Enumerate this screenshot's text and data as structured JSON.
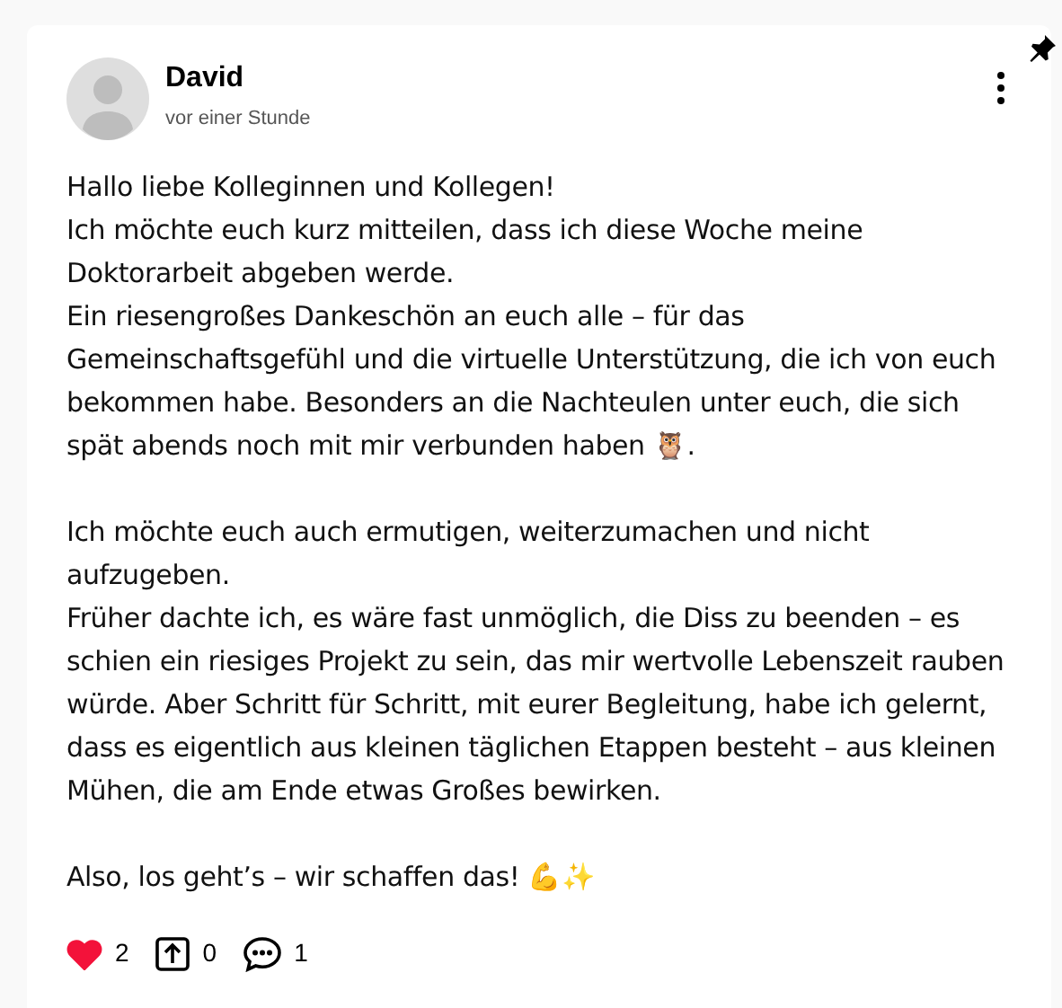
{
  "post": {
    "author": "David",
    "time": "vor einer Stunde",
    "pinned": true,
    "paragraphs": [
      [
        "Hallo liebe Kolleginnen und Kollegen!",
        "Ich möchte euch kurz mitteilen, dass ich diese Woche meine Doktorarbeit abgeben werde.",
        "Ein riesengroßes Dankeschön an euch alle – für das Gemeinschaftsgefühl und die virtuelle Unterstützung, die ich von euch bekommen habe. Besonders an die Nachteulen unter euch, die sich spät abends noch mit mir verbunden haben 🦉."
      ],
      [
        "Ich möchte euch auch ermutigen, weiterzumachen und nicht aufzugeben.",
        "Früher dachte ich, es wäre fast unmöglich, die Diss zu beenden – es schien ein riesiges Projekt zu sein, das mir wertvolle Lebenszeit rauben würde. Aber Schritt für Schritt, mit eurer Begleitung, habe ich gelernt, dass es eigentlich aus kleinen täglichen Etappen besteht – aus kleinen Mühen, die am Ende etwas Großes bewirken."
      ],
      [
        "Also, los geht’s – wir schaffen das! 💪✨"
      ]
    ],
    "actions": [
      {
        "kind": "like",
        "count": "2",
        "selected": true
      },
      {
        "kind": "share",
        "count": "0"
      },
      {
        "kind": "comment",
        "count": "1"
      }
    ]
  }
}
